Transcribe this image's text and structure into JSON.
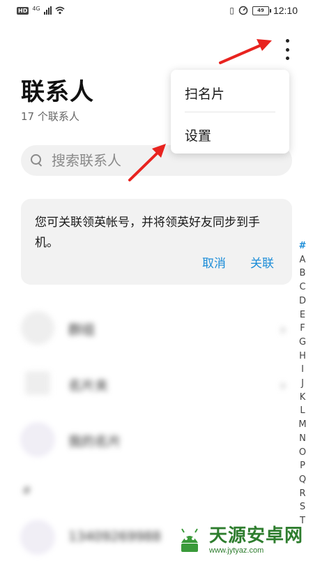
{
  "status_bar": {
    "network_badge": "HD",
    "network_type": "4G",
    "battery": "49",
    "time": "12:10"
  },
  "header": {
    "title": "联系人",
    "subtitle": "17 个联系人",
    "more_icon": "more-vertical-icon"
  },
  "search": {
    "placeholder": "搜索联系人"
  },
  "menu": {
    "items": [
      "扫名片",
      "设置"
    ]
  },
  "banner": {
    "text": "您可关联领英帐号，并将领英好友同步到手机。",
    "cancel_label": "取消",
    "link_label": "关联"
  },
  "list": {
    "rows": [
      {
        "label": "群组"
      },
      {
        "label": "名片夹"
      },
      {
        "label": "我的名片"
      }
    ],
    "section_header": "#",
    "contact_number": "13409269988"
  },
  "alphabet_index": [
    "#",
    "A",
    "B",
    "C",
    "D",
    "E",
    "F",
    "G",
    "H",
    "I",
    "J",
    "K",
    "L",
    "M",
    "N",
    "O",
    "P",
    "Q",
    "R",
    "S",
    "T"
  ],
  "watermark": {
    "title": "天源安卓网",
    "url": "www.jytyaz.com"
  },
  "colors": {
    "accent": "#1a8cd8",
    "annotation_arrow": "#e8231f",
    "watermark": "#2e7d2e"
  }
}
